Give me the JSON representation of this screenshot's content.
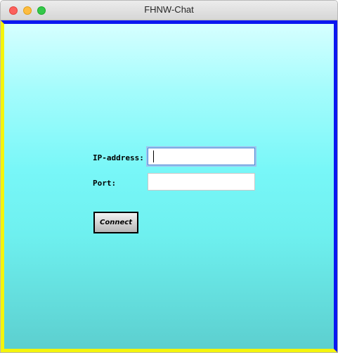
{
  "window": {
    "title": "FHNW-Chat"
  },
  "form": {
    "ip_label": "IP-address:",
    "ip_value": "",
    "port_label": "Port:",
    "port_value": "",
    "connect_label": "Connect"
  },
  "colors": {
    "border_top_right": "#0a17f0",
    "border_bottom_left": "#f4f40c",
    "background_top": "#d6ffff",
    "background_bottom": "#5ccfcf"
  }
}
